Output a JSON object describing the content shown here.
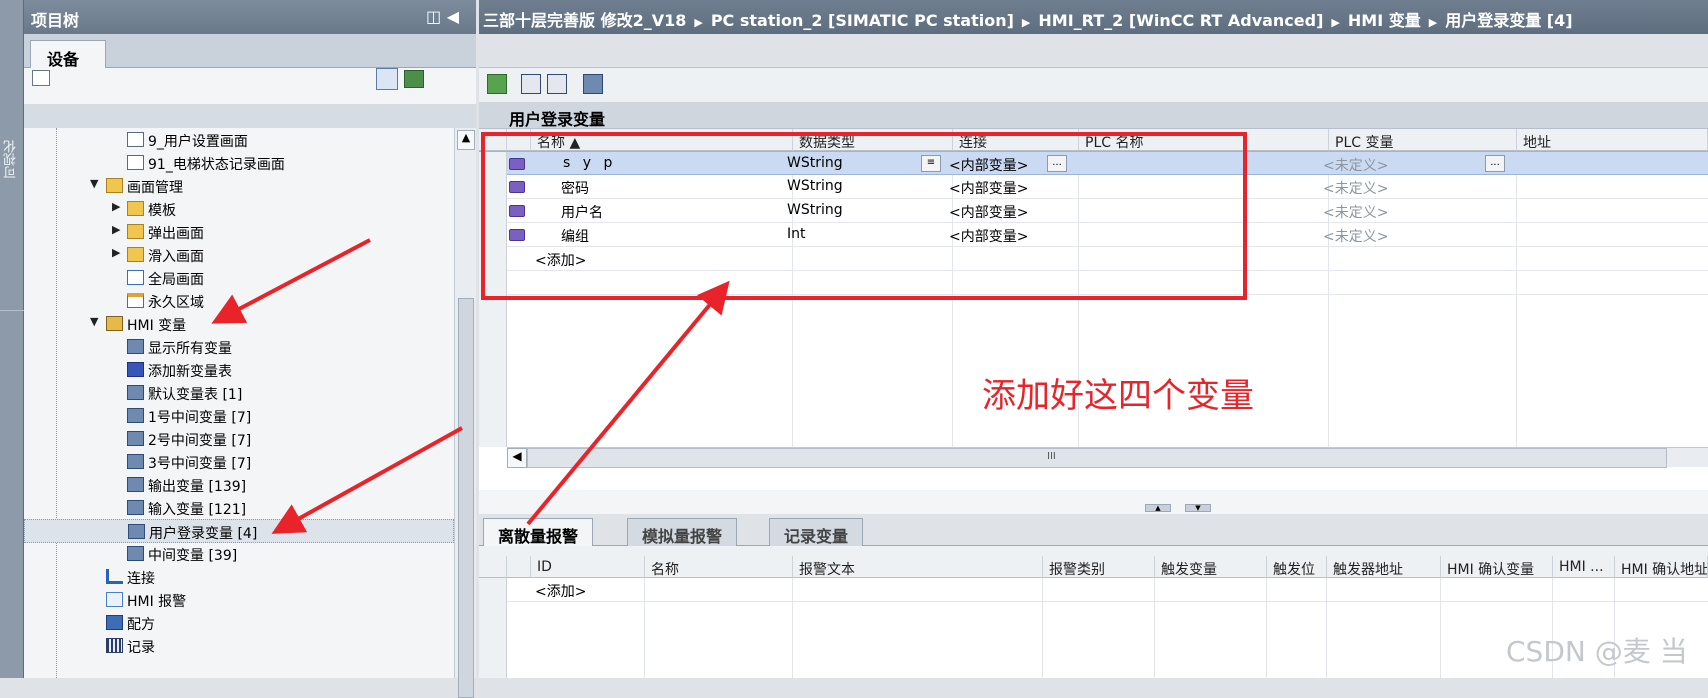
{
  "sidebar_strip": {
    "label": "可视化"
  },
  "tree": {
    "title": "项目树",
    "tab": "设备",
    "items": [
      {
        "label": "9_用户设置画面"
      },
      {
        "label": "91_电梯状态记录画面"
      },
      {
        "label": "画面管理"
      },
      {
        "label": "模板"
      },
      {
        "label": "弹出画面"
      },
      {
        "label": "滑入画面"
      },
      {
        "label": "全局画面"
      },
      {
        "label": "永久区域"
      },
      {
        "label": "HMI 变量"
      },
      {
        "label": "显示所有变量"
      },
      {
        "label": "添加新变量表"
      },
      {
        "label": "默认变量表 [1]"
      },
      {
        "label": "1号中间变量 [7]"
      },
      {
        "label": "2号中间变量 [7]"
      },
      {
        "label": "3号中间变量 [7]"
      },
      {
        "label": "输出变量 [139]"
      },
      {
        "label": "输入变量 [121]"
      },
      {
        "label": "用户登录变量 [4]"
      },
      {
        "label": "中间变量 [39]"
      },
      {
        "label": "连接"
      },
      {
        "label": "HMI 报警"
      },
      {
        "label": "配方"
      },
      {
        "label": "记录"
      }
    ]
  },
  "breadcrumb": [
    "三部十层完善版 修改2_V18",
    "PC station_2 [SIMATIC PC station]",
    "HMI_RT_2 [WinCC RT Advanced]",
    "HMI 变量",
    "用户登录变量 [4]"
  ],
  "tag_table": {
    "title": "用户登录变量",
    "columns": [
      "名称 ▲",
      "数据类型",
      "连接",
      "PLC 名称",
      "PLC 变量",
      "地址"
    ],
    "rows": [
      {
        "name": "s y p",
        "type": "WString",
        "connection": "<内部变量>",
        "plc_name": "",
        "plc_tag": "<未定义>"
      },
      {
        "name": "密码",
        "type": "WString",
        "connection": "<内部变量>",
        "plc_name": "",
        "plc_tag": "<未定义>"
      },
      {
        "name": "用户名",
        "type": "WString",
        "connection": "<内部变量>",
        "plc_name": "",
        "plc_tag": "<未定义>"
      },
      {
        "name": "编组",
        "type": "Int",
        "connection": "<内部变量>",
        "plc_name": "",
        "plc_tag": "<未定义>"
      }
    ],
    "add_label": "<添加>",
    "ellipsis": "...",
    "scroll_grip": "III"
  },
  "alarm": {
    "tabs": [
      "离散量报警",
      "模拟量报警",
      "记录变量"
    ],
    "columns": [
      "ID",
      "名称",
      "报警文本",
      "报警类别",
      "触发变量",
      "触发位",
      "触发器地址",
      "HMI 确认变量",
      "HMI ...",
      "HMI 确认地址"
    ],
    "add_label": "<添加>"
  },
  "annotation": {
    "text": "添加好这四个变量"
  },
  "watermark": "CSDN @麦 当",
  "colors": {
    "accent": "#e8232a",
    "title_bar": "#6a7989"
  }
}
